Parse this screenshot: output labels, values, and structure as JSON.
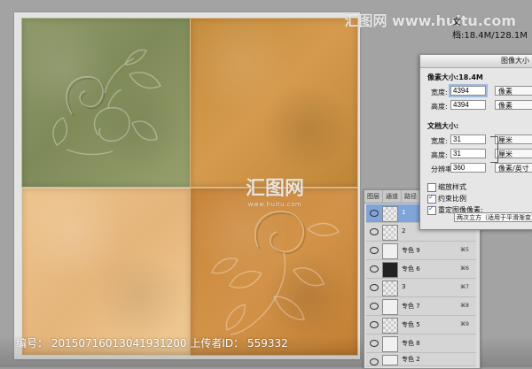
{
  "watermarks": {
    "top": "汇图网 www.huitu.com",
    "center_main": "汇图网",
    "center_sub": "www.huitu.com",
    "bottom_label_id": "编号：",
    "bottom_id_value": "20150716013041931200",
    "bottom_uploader_label": "上传者ID：",
    "bottom_uploader_value": "559332"
  },
  "top_panel": {
    "document_info": "文档:18.4M/128.1M"
  },
  "image_size_dialog": {
    "title": "图像大小",
    "pixel_dimensions_label": "像素大小:18.4M",
    "width_label": "宽度:",
    "width_value": "4394",
    "width_unit": "像素",
    "height_label": "高度:",
    "height_value": "4394",
    "height_unit": "像素",
    "document_size_label": "文档大小:",
    "doc_width_label": "宽度:",
    "doc_width_value": "31",
    "doc_width_unit": "厘米",
    "doc_height_label": "高度:",
    "doc_height_value": "31",
    "doc_height_unit": "厘米",
    "resolution_label": "分辨率:",
    "resolution_value": "360",
    "resolution_unit": "像素/英寸",
    "scale_styles_label": "缩放样式",
    "constrain_label": "约束比例",
    "resample_label": "重定图像像素:",
    "resample_method": "两次立方（适用于平滑渐变）",
    "checkboxes": {
      "scale_styles": false,
      "constrain": true,
      "resample": true
    }
  },
  "layers_panel": {
    "tabs": [
      "图层",
      "通道",
      "路径"
    ],
    "rows": [
      {
        "name": "1",
        "shortcut": "",
        "thumb": "pattern",
        "active": true
      },
      {
        "name": "2",
        "shortcut": "",
        "thumb": "pattern",
        "active": false
      },
      {
        "name": "专色 9",
        "shortcut": "⌘5",
        "thumb": "white",
        "active": false
      },
      {
        "name": "专色 6",
        "shortcut": "⌘6",
        "thumb": "dark",
        "active": false
      },
      {
        "name": "3",
        "shortcut": "⌘7",
        "thumb": "pattern",
        "active": false
      },
      {
        "name": "专色 7",
        "shortcut": "⌘8",
        "thumb": "white",
        "active": false
      },
      {
        "name": "专色 5",
        "shortcut": "⌘9",
        "thumb": "pattern",
        "active": false
      },
      {
        "name": "专色 8",
        "shortcut": "",
        "thumb": "white",
        "active": false
      },
      {
        "name": "专色 2",
        "shortcut": "",
        "thumb": "white",
        "active": false
      }
    ]
  }
}
